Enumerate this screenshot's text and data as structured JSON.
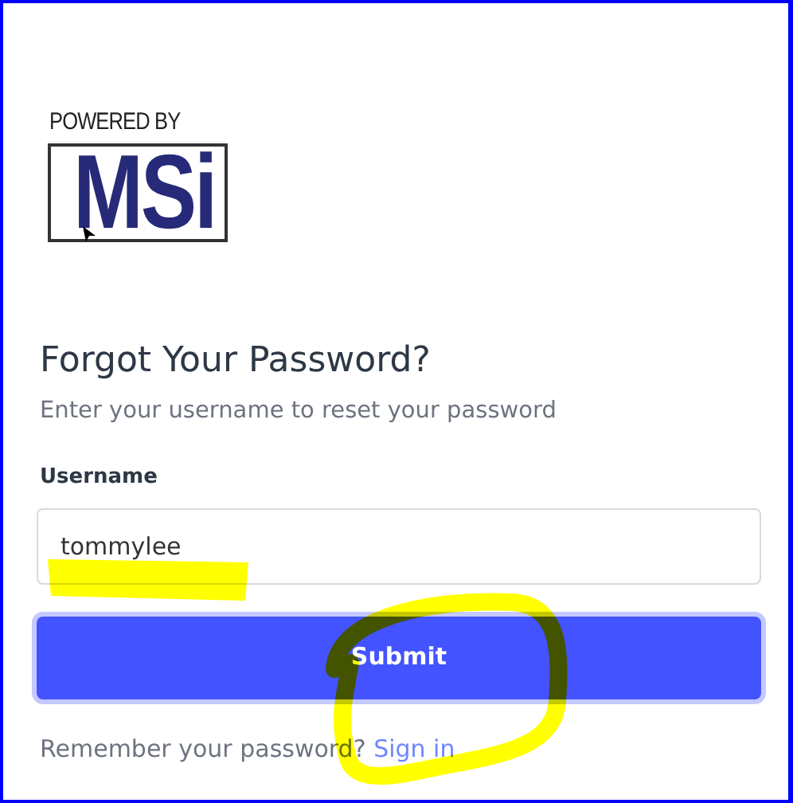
{
  "logo": {
    "tagline": "POWERED BY",
    "mark": "MSi"
  },
  "title": "Forgot Your Password?",
  "subtitle": "Enter your username to reset your password",
  "username": {
    "label": "Username",
    "value": "tommylee"
  },
  "submit_button": "Submit",
  "footer": {
    "text": "Remember your password?",
    "link": "Sign in"
  }
}
